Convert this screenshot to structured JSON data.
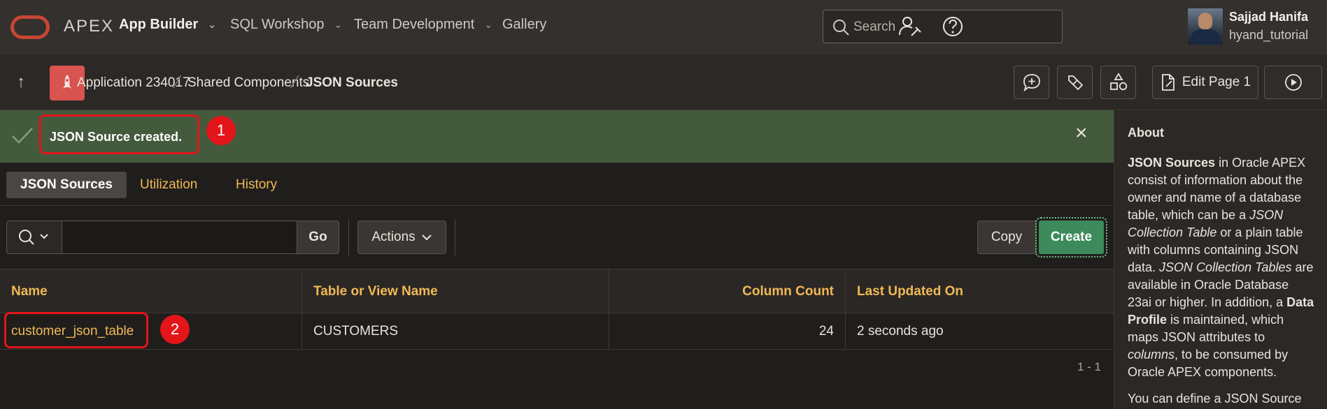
{
  "topbar": {
    "brand": "APEX",
    "nav": [
      {
        "label": "App Builder"
      },
      {
        "label": "SQL Workshop"
      },
      {
        "label": "Team Development"
      },
      {
        "label": "Gallery"
      }
    ],
    "search_placeholder": "Search",
    "user": {
      "name": "Sajjad Hanifa",
      "workspace": "hyand_tutorial"
    }
  },
  "breadcrumb": [
    "Application 234017",
    "Shared Components",
    "JSON Sources"
  ],
  "toolbar_right": {
    "edit_page_label": "Edit Page 1"
  },
  "banner": {
    "message": "JSON Source created."
  },
  "callouts": [
    "1",
    "2"
  ],
  "tabs": [
    {
      "label": "JSON Sources",
      "active": true
    },
    {
      "label": "Utilization",
      "active": false
    },
    {
      "label": "History",
      "active": false
    }
  ],
  "report_toolbar": {
    "go_label": "Go",
    "actions_label": "Actions",
    "copy_label": "Copy",
    "create_label": "Create"
  },
  "table": {
    "columns": [
      "Name",
      "Table or View Name",
      "Column Count",
      "Last Updated On"
    ],
    "rows": [
      {
        "name": "customer_json_table",
        "table": "CUSTOMERS",
        "column_count": "24",
        "updated": "2 seconds ago"
      }
    ],
    "pagination": "1 - 1"
  },
  "about": {
    "title": "About",
    "p1": {
      "t1": "JSON Sources",
      "t2": " in Oracle APEX consist of information about the owner and name of a database table, which can be a ",
      "t3": "JSON Collection Table",
      "t4": " or a plain table with columns containing JSON data. ",
      "t5": "JSON Collection Tables",
      "t6": " are available in Oracle Database 23ai or higher. In addition, a ",
      "t7": "Data Profile",
      "t8": " is maintained, which maps JSON attributes to ",
      "t9": "columns",
      "t10": ", to be consumed by Oracle APEX components."
    },
    "p2": "You can define a JSON Source"
  },
  "colors": {
    "accent": "#f0b955",
    "banner": "#435a3d",
    "create": "#3d8a5a",
    "callout": "#e4141b",
    "app_icon": "#d9534f"
  }
}
